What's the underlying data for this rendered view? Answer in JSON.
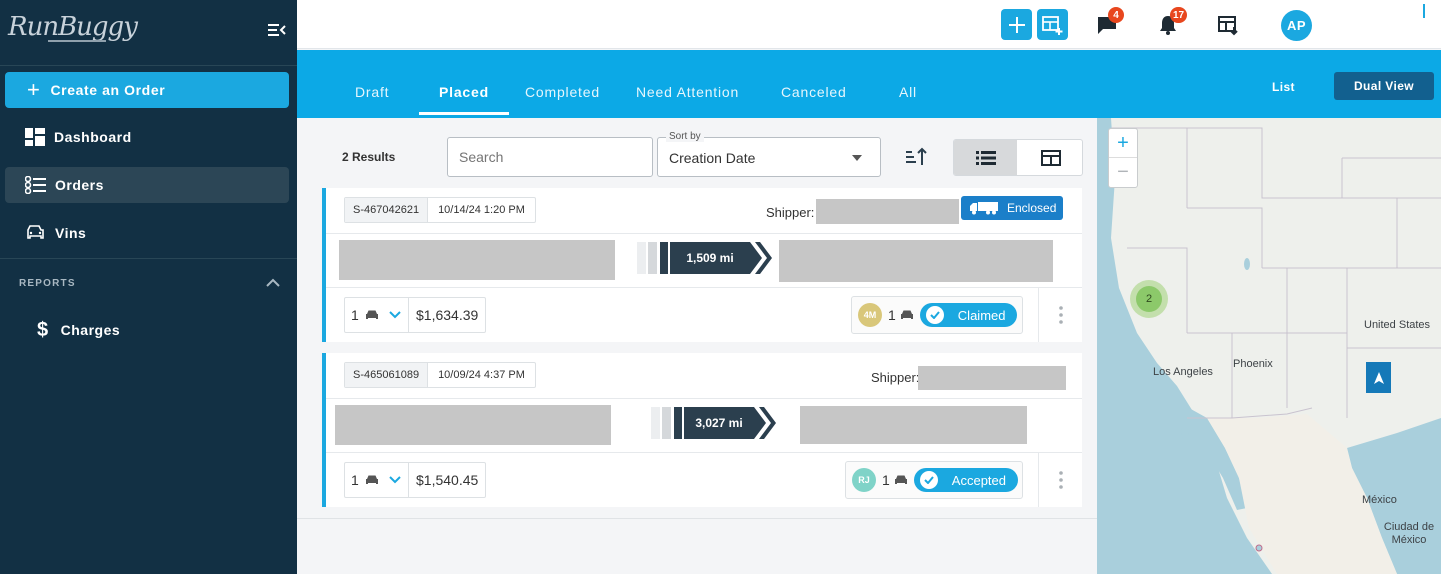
{
  "sidebar": {
    "logo": "RunBuggy",
    "create_label": "Create an Order",
    "items": [
      {
        "label": "Dashboard"
      },
      {
        "label": "Orders"
      },
      {
        "label": "Vins"
      }
    ],
    "reports_label": "REPORTS",
    "reports_items": [
      {
        "label": "Charges"
      }
    ]
  },
  "header": {
    "messages_badge": "4",
    "notifications_badge": "17",
    "avatar_initials": "AP"
  },
  "tabs": [
    "Draft",
    "Placed",
    "Completed",
    "Need Attention",
    "Canceled",
    "All"
  ],
  "active_tab": "Placed",
  "view_modes": {
    "list": "List",
    "dual": "Dual View"
  },
  "toolbar": {
    "results": "2 Results",
    "search_placeholder": "Search",
    "sort_label": "Sort by",
    "sort_value": "Creation Date"
  },
  "orders": [
    {
      "id": "S-467042621",
      "date": "10/14/24 1:20 PM",
      "shipper_label": "Shipper:",
      "transport": "Enclosed",
      "distance": "1,509 mi",
      "vehicles": "1",
      "price": "$1,634.39",
      "carrier_initials": "4M",
      "carrier_count": "1",
      "status": "Claimed"
    },
    {
      "id": "S-465061089",
      "date": "10/09/24 4:37 PM",
      "shipper_label": "Shipper:",
      "distance": "3,027 mi",
      "vehicles": "1",
      "price": "$1,540.45",
      "carrier_initials": "RJ",
      "carrier_count": "1",
      "status": "Accepted"
    }
  ],
  "map": {
    "labels": {
      "united_states": "United States",
      "phoenix": "Phoenix",
      "los_angeles": "Los Angeles",
      "mexico": "México",
      "ciudad_de_mexico": "Ciudad de México"
    },
    "cluster_count": "2"
  },
  "colors": {
    "sidebar_bg": "#123044",
    "accent": "#1ba8e0",
    "tab_bar": "#0ca9e6",
    "badge": "#e8471e",
    "enclosed": "#1b7fc9"
  }
}
